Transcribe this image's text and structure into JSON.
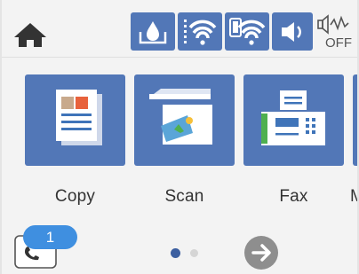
{
  "status_bar": {
    "home_icon": "home-icon",
    "icons": [
      {
        "name": "ink-level-icon",
        "highlighted": true
      },
      {
        "name": "wifi-icon",
        "highlighted": true
      },
      {
        "name": "wifi-direct-icon",
        "highlighted": true
      },
      {
        "name": "speaker-icon",
        "highlighted": true
      },
      {
        "name": "quiet-mode-off-icon",
        "highlighted": false,
        "label": "OFF"
      }
    ]
  },
  "apps": [
    {
      "label": "Copy",
      "icon": "copy-icon"
    },
    {
      "label": "Scan",
      "icon": "scan-icon"
    },
    {
      "label": "Fax",
      "icon": "fax-icon"
    },
    {
      "label": "M",
      "icon": "more-icon"
    }
  ],
  "fax_job": {
    "icon": "fax-job-icon",
    "badge_count": "1"
  },
  "pagination": {
    "current_page": 1,
    "total_pages": 2
  },
  "colors": {
    "tile": "#5277b7",
    "badge": "#3f8fe0",
    "next_button": "#8e8e8e",
    "page_dot_active": "#3c5fa0",
    "page_dot_inactive": "#d5d5d5"
  }
}
